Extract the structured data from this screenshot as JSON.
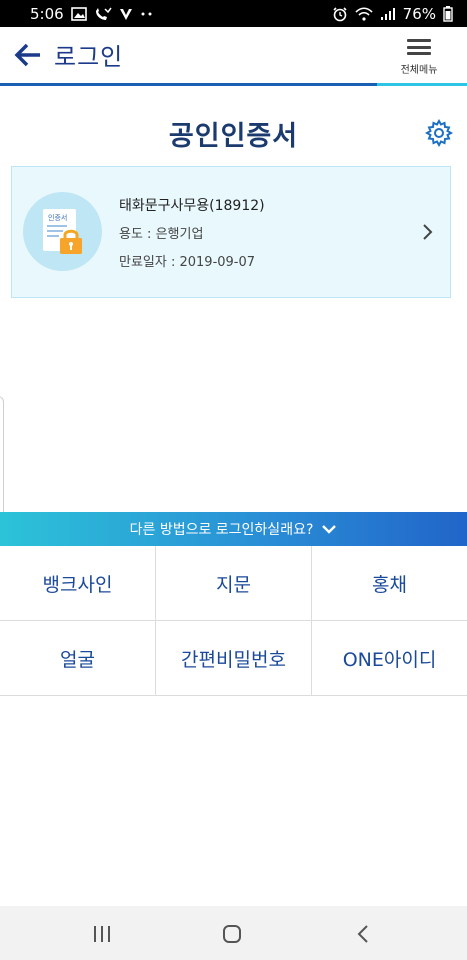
{
  "status_bar": {
    "time": "5:06",
    "battery": "76%",
    "left_icons": [
      "gallery-icon",
      "missed-call-icon",
      "v-icon",
      "more-dots-icon"
    ],
    "right_icons": [
      "alarm-icon",
      "wifi-icon",
      "signal-icon",
      "battery-icon"
    ]
  },
  "header": {
    "title": "로그인",
    "menu_label": "전체메뉴",
    "accent_color": "#1a5fb4"
  },
  "page": {
    "title": "공인인증서"
  },
  "certificate": {
    "name": "태화문구사무용(18912)",
    "usage": "용도 : 은행기업",
    "expiry": "만료일자 : 2019-09-07",
    "badge_text": "인증서"
  },
  "alt_login": {
    "banner": "다른 방법으로 로그인하실래요?",
    "options": [
      "뱅크사인",
      "지문",
      "홍채",
      "얼굴",
      "간편비밀번호",
      "ONE아이디"
    ]
  },
  "nav": {
    "icons": [
      "recent-apps-icon",
      "home-icon",
      "back-icon"
    ]
  }
}
